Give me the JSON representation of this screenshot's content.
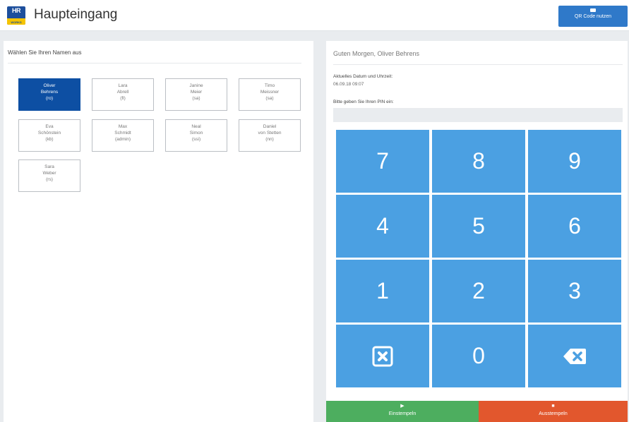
{
  "header": {
    "logo_text": "HR",
    "logo_sub": "WORKS",
    "title": "Haupteingang",
    "qr_button_label": "QR Code nutzen"
  },
  "users_panel": {
    "heading": "Wählen Sie Ihren Namen aus",
    "users": [
      {
        "first": "Oliver",
        "last": "Behrens",
        "code": "(ro)",
        "active": true
      },
      {
        "first": "Lara",
        "last": "Abrell",
        "code": "(fl)",
        "active": false
      },
      {
        "first": "Janine",
        "last": "Meier",
        "code": "(sa)",
        "active": false
      },
      {
        "first": "Timo",
        "last": "Meissner",
        "code": "(sa)",
        "active": false
      },
      {
        "first": "Eva",
        "last": "Schönstein",
        "code": "(kb)",
        "active": false
      },
      {
        "first": "Max",
        "last": "Schmidt",
        "code": "(admin)",
        "active": false
      },
      {
        "first": "Neal",
        "last": "Simon",
        "code": "(ssi)",
        "active": false
      },
      {
        "first": "Daniel",
        "last": "von Stetten",
        "code": "(nn)",
        "active": false
      },
      {
        "first": "Sara",
        "last": "Weber",
        "code": "(rs)",
        "active": false
      }
    ]
  },
  "pin_panel": {
    "greeting": "Guten Morgen, Oliver Behrens",
    "datetime_label": "Aktuelles Datum und Uhrzeit:",
    "datetime_value": "06.09.18 09:07",
    "pin_label": "Bitte geben Sie Ihren PIN ein:",
    "pin_value": "",
    "keys": [
      "7",
      "8",
      "9",
      "4",
      "5",
      "6",
      "1",
      "2",
      "3",
      "clear",
      "0",
      "backspace"
    ],
    "key_icons": {
      "clear": "clear-x-icon",
      "backspace": "backspace-icon"
    },
    "stamp_in_label": "Einstempeln",
    "stamp_out_label": "Ausstempeln",
    "colors": {
      "keypad": "#4ba0e2",
      "stamp_in": "#4dae5f",
      "stamp_out": "#e2572d",
      "active_user": "#0d4fa3"
    }
  }
}
